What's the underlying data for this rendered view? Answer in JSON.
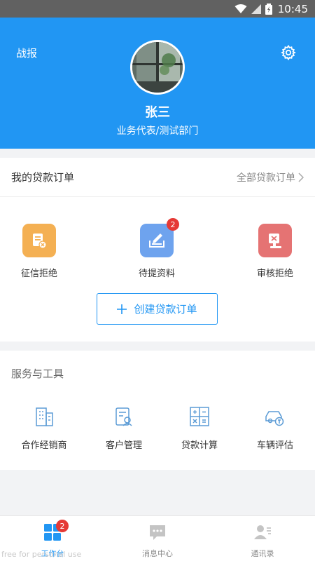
{
  "status_bar": {
    "time": "10:45"
  },
  "header": {
    "left_link": "战报",
    "name": "张三",
    "department": "业务代表/测试部门"
  },
  "orders": {
    "title": "我的贷款订单",
    "more": "全部贷款订单",
    "items": [
      {
        "label": "征信拒绝",
        "icon": "credit-reject-icon",
        "color": "#f4b053"
      },
      {
        "label": "待提资料",
        "icon": "pending-docs-icon",
        "color": "#6ea3ee",
        "badge": "2"
      },
      {
        "label": "审核拒绝",
        "icon": "review-reject-icon",
        "color": "#e57373"
      }
    ],
    "create_button": "创建贷款订单"
  },
  "tools": {
    "title": "服务与工具",
    "items": [
      {
        "label": "合作经销商",
        "icon": "dealer-building-icon"
      },
      {
        "label": "客户管理",
        "icon": "customer-management-icon"
      },
      {
        "label": "贷款计算",
        "icon": "calculator-icon"
      },
      {
        "label": "车辆评估",
        "icon": "car-evaluation-icon"
      }
    ]
  },
  "tabbar": {
    "items": [
      {
        "label": "工作台",
        "badge": "2",
        "active": true
      },
      {
        "label": "消息中心"
      },
      {
        "label": "通讯录"
      }
    ]
  },
  "watermark": "free for personal use",
  "colors": {
    "primary": "#2196f3",
    "badge": "#e53935"
  }
}
